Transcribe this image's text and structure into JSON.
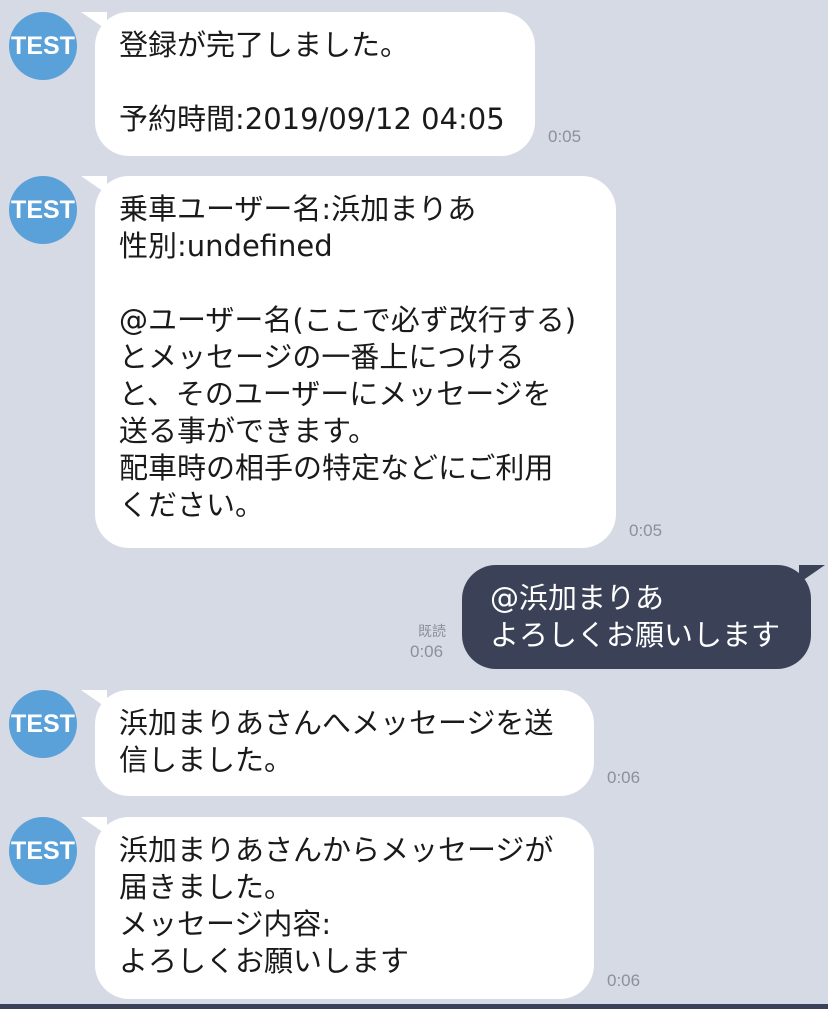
{
  "chat": {
    "avatar_label": "TEST",
    "messages": [
      {
        "text": "登録が完了しました。\n\n予約時間:2019/09/12 04:05",
        "time": "0:05"
      },
      {
        "text": "乗車ユーザー名:浜加まりあ\n性別:undefined\n\n@ユーザー名(ここで必ず改行する)\nとメッセージの一番上につける\nと、そのユーザーにメッセージを\n送る事ができます。\n配車時の相手の特定などにご利用\nください。",
        "time": "0:05"
      },
      {
        "text": "@浜加まりあ\nよろしくお願いします",
        "time": "0:06",
        "read": "既読"
      },
      {
        "text": "浜加まりあさんへメッセージを送\n信しました。",
        "time": "0:06"
      },
      {
        "text": "浜加まりあさんからメッセージが\n届きました。\nメッセージ内容:\nよろしくお願いします",
        "time": "0:06"
      }
    ]
  }
}
